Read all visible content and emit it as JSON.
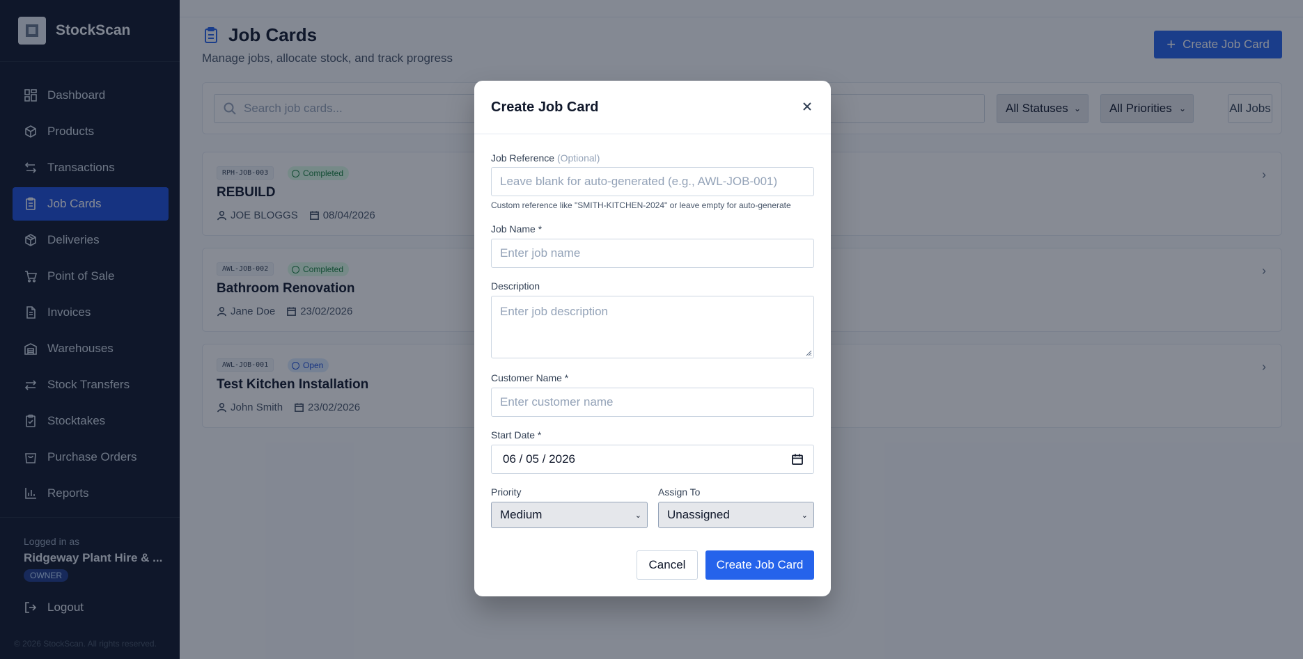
{
  "app": {
    "name": "StockScan",
    "copyright": "© 2026 StockScan. All rights reserved."
  },
  "sidebar": {
    "items": [
      {
        "label": "Dashboard",
        "icon": "dashboard-icon"
      },
      {
        "label": "Products",
        "icon": "box-icon"
      },
      {
        "label": "Transactions",
        "icon": "arrows-icon"
      },
      {
        "label": "Job Cards",
        "icon": "clipboard-icon",
        "active": true
      },
      {
        "label": "Deliveries",
        "icon": "package-icon"
      },
      {
        "label": "Point of Sale",
        "icon": "cart-icon"
      },
      {
        "label": "Invoices",
        "icon": "document-icon"
      },
      {
        "label": "Warehouses",
        "icon": "warehouse-icon"
      },
      {
        "label": "Stock Transfers",
        "icon": "transfer-icon"
      },
      {
        "label": "Stocktakes",
        "icon": "clipboard-check-icon"
      },
      {
        "label": "Purchase Orders",
        "icon": "bag-icon"
      },
      {
        "label": "Reports",
        "icon": "bar-chart-icon"
      }
    ],
    "logged_in_label": "Logged in as",
    "user": "Ridgeway Plant Hire & ...",
    "role": "OWNER",
    "logout": "Logout"
  },
  "page": {
    "title": "Job Cards",
    "subtitle": "Manage jobs, allocate stock, and track progress",
    "create_button": "Create Job Card"
  },
  "filters": {
    "search_placeholder": "Search job cards...",
    "status": "All Statuses",
    "priority": "All Priorities",
    "all_jobs": "All Jobs"
  },
  "jobs": [
    {
      "ref": "RPH-JOB-003",
      "status": "Completed",
      "name": "REBUILD",
      "customer": "JOE BLOGGS",
      "date": "08/04/2026"
    },
    {
      "ref": "AWL-JOB-002",
      "status": "Completed",
      "name": "Bathroom Renovation",
      "customer": "Jane Doe",
      "date": "23/02/2026"
    },
    {
      "ref": "AWL-JOB-001",
      "status": "Open",
      "name": "Test Kitchen Installation",
      "customer": "John Smith",
      "date": "23/02/2026"
    }
  ],
  "modal": {
    "title": "Create Job Card",
    "job_reference_label": "Job Reference",
    "job_reference_optional": "(Optional)",
    "job_reference_placeholder": "Leave blank for auto-generated (e.g., AWL-JOB-001)",
    "job_reference_hint": "Custom reference like \"SMITH-KITCHEN-2024\" or leave empty for auto-generate",
    "job_name_label": "Job Name *",
    "job_name_placeholder": "Enter job name",
    "description_label": "Description",
    "description_placeholder": "Enter job description",
    "customer_label": "Customer Name *",
    "customer_placeholder": "Enter customer name",
    "start_date_label": "Start Date *",
    "start_date_value": "06 / 05 / 2026",
    "priority_label": "Priority",
    "priority_value": "Medium",
    "assign_label": "Assign To",
    "assign_value": "Unassigned",
    "cancel": "Cancel",
    "submit": "Create Job Card"
  },
  "colors": {
    "primary": "#2563eb",
    "sidebar_bg": "#0f172a",
    "completed": "#15803d",
    "open": "#1d4ed8"
  }
}
